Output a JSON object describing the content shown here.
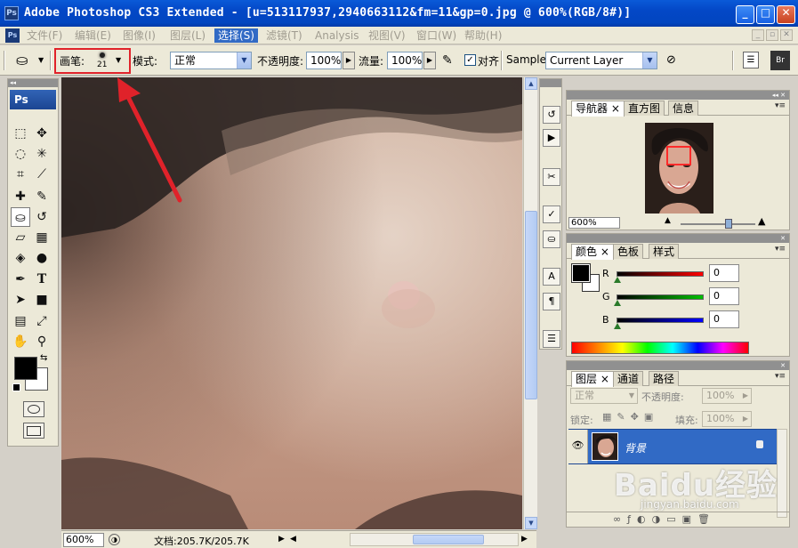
{
  "window": {
    "app_icon": "Ps",
    "title": "Adobe Photoshop CS3 Extended - [u=513117937,2940663112&fm=11&gp=0.jpg @ 600%(RGB/8#)]",
    "buttons": [
      "minimize",
      "maximize",
      "close"
    ]
  },
  "menubar": {
    "icon": "Ps",
    "items": [
      {
        "label": "文件(F)"
      },
      {
        "label": "编辑(E)"
      },
      {
        "label": "图像(I)"
      },
      {
        "label": "图层(L)"
      },
      {
        "label": "选择(S)",
        "active": true
      },
      {
        "label": "滤镜(T)"
      },
      {
        "label": "Analysis"
      },
      {
        "label": "视图(V)"
      },
      {
        "label": "窗口(W)"
      },
      {
        "label": "帮助(H)"
      }
    ]
  },
  "options": {
    "brush_label": "画笔:",
    "brush_size": "21",
    "mode_label": "模式:",
    "mode_value": "正常",
    "opacity_label": "不透明度:",
    "opacity_value": "100%",
    "flow_label": "流量:",
    "flow_value": "100%",
    "aligned_label": "对齐",
    "aligned_checked": true,
    "sample_label": "Sample:",
    "sample_value": "Current Layer"
  },
  "toolbox": {
    "logo": "Ps",
    "tools": [
      "marquee-tool",
      "move-tool",
      "lasso-tool",
      "magic-wand-tool",
      "crop-tool",
      "slice-tool",
      "healing-brush-tool",
      "brush-tool",
      "clone-stamp-tool",
      "history-brush-tool",
      "eraser-tool",
      "gradient-tool",
      "blur-tool",
      "dodge-tool",
      "pen-tool",
      "type-tool",
      "path-selection-tool",
      "shape-tool",
      "notes-tool",
      "eyedropper-tool",
      "hand-tool",
      "zoom-tool"
    ],
    "foreground_color": "#000000",
    "background_color": "#ffffff"
  },
  "statusbar": {
    "zoom": "600%",
    "doc_info": "文档:205.7K/205.7K"
  },
  "navigator": {
    "tabs": [
      "导航器",
      "直方图",
      "信息"
    ],
    "zoom": "600%"
  },
  "color": {
    "tabs": [
      "颜色",
      "色板",
      "样式"
    ],
    "channels": [
      {
        "label": "R",
        "value": "0",
        "color": "#ff0000"
      },
      {
        "label": "G",
        "value": "0",
        "color": "#00c000"
      },
      {
        "label": "B",
        "value": "0",
        "color": "#0000ff"
      }
    ]
  },
  "layers": {
    "tabs": [
      "图层",
      "通道",
      "路径"
    ],
    "blend_mode": "正常",
    "opacity_label": "不透明度:",
    "opacity_value": "100%",
    "lock_label": "锁定:",
    "fill_label": "填充:",
    "fill_value": "100%",
    "layer_name": "背景"
  },
  "watermark": {
    "brand": "Baidu经验",
    "url": "jingyan.baidu.com"
  }
}
